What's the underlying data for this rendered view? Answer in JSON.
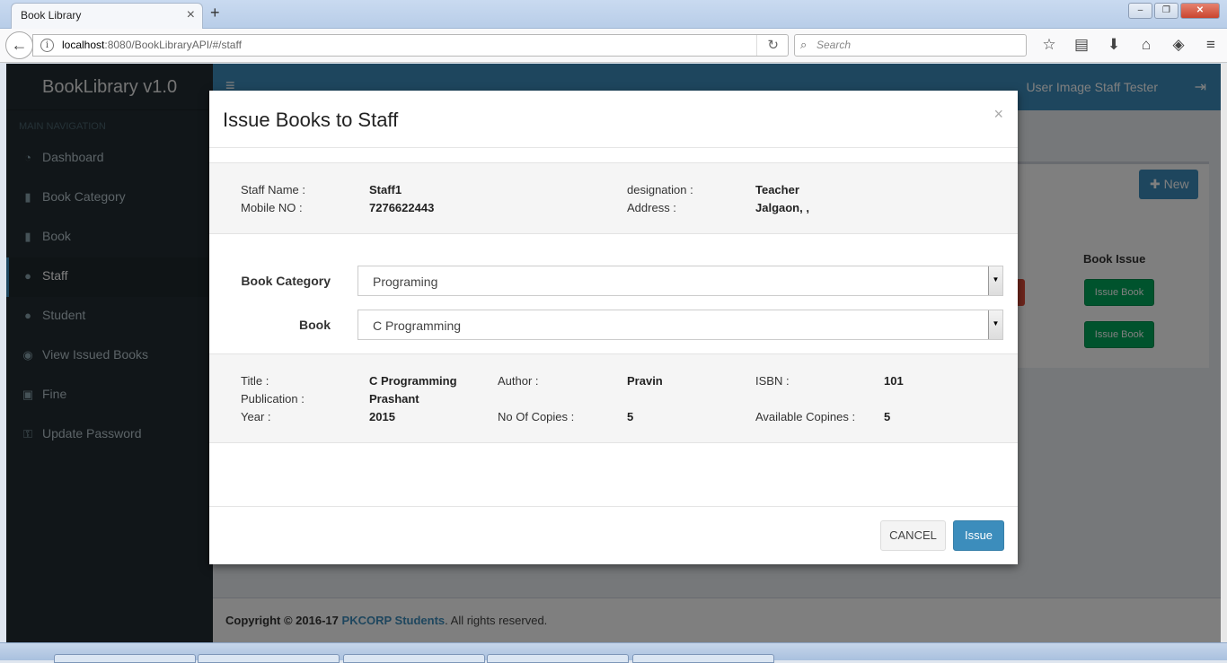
{
  "browser": {
    "tab_title": "Book Library",
    "tab_close": "×",
    "new_tab": "+",
    "url_host": "localhost",
    "url_path": ":8080/BookLibraryAPI/#/staff",
    "search_placeholder": "Search",
    "window_buttons": [
      "–",
      "❐",
      "✕"
    ]
  },
  "app": {
    "brand": "BookLibrary v1.0",
    "nav_header": "MAIN NAVIGATION",
    "nav_items": [
      {
        "label": "Dashboard",
        "icon": "dashboard-icon"
      },
      {
        "label": "Book Category",
        "icon": "book-icon"
      },
      {
        "label": "Book",
        "icon": "book-icon"
      },
      {
        "label": "Staff",
        "icon": "user-icon",
        "active": true
      },
      {
        "label": "Student",
        "icon": "user-icon"
      },
      {
        "label": "View Issued Books",
        "icon": "eye-icon"
      },
      {
        "label": "Fine",
        "icon": "money-icon"
      },
      {
        "label": "Update Password",
        "icon": "key-icon"
      }
    ],
    "user_label": "User Image Staff Tester",
    "new_button": "New",
    "table_header_issue": "Book Issue",
    "issue_book_buttons": [
      "Issue Book",
      "Issue Book"
    ],
    "footer": {
      "copyright": "Copyright © 2016-17",
      "org": "PKCORP Students",
      "rights": ". All rights reserved."
    }
  },
  "modal": {
    "title": "Issue Books to Staff",
    "close": "×",
    "staff": {
      "name_label": "Staff Name :",
      "name_value": "Staff1",
      "mobile_label": "Mobile NO :",
      "mobile_value": "7276622443",
      "designation_label": "designation :",
      "designation_value": "Teacher",
      "address_label": "Address :",
      "address_value": "Jalgaon, ,"
    },
    "form": {
      "category_label": "Book Category",
      "category_value": "Programing",
      "book_label": "Book",
      "book_value": "C Programming"
    },
    "book": {
      "title_label": "Title :",
      "title_value": "C Programming",
      "publication_label": "Publication :",
      "publication_value": "Prashant",
      "year_label": "Year :",
      "year_value": "2015",
      "author_label": "Author :",
      "author_value": "Pravin",
      "copies_label": "No Of Copies :",
      "copies_value": "5",
      "isbn_label": "ISBN :",
      "isbn_value": "101",
      "available_label": "Available Copines :",
      "available_value": "5"
    },
    "cancel_button": "CANCEL",
    "issue_button": "Issue"
  }
}
